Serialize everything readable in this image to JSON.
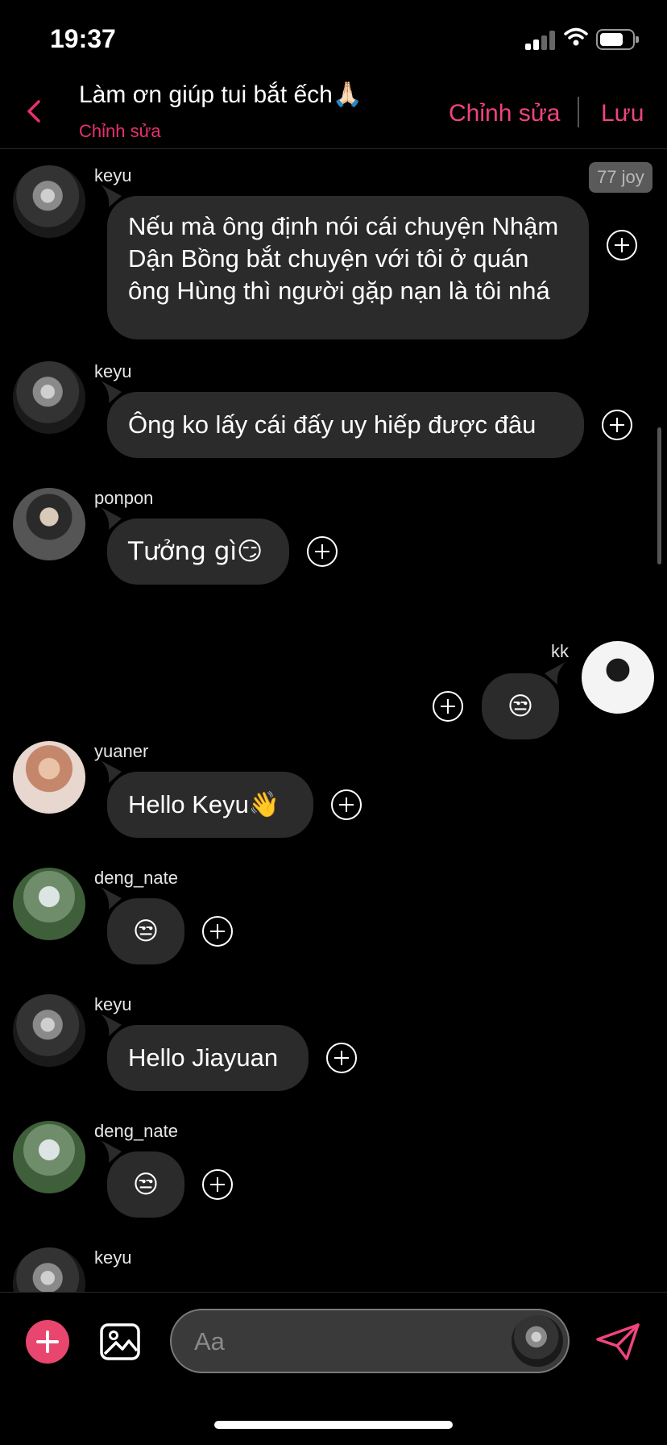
{
  "status": {
    "time": "19:37"
  },
  "header": {
    "title": "Làm ơn giúp tui bắt ếch🙏🏻",
    "subtitle": "Chỉnh sửa",
    "edit_label": "Chỉnh sửa",
    "save_label": "Lưu"
  },
  "joy_badge": "77 joy",
  "messages": [
    {
      "sender": "keyu",
      "text": "Nếu mà ông định nói cái chuyện Nhậm Dận Bồng bắt chuyện với tôi ở quán ông Hùng thì người gặp nạn là tôi nhá",
      "avatar": "keyu-avatar"
    },
    {
      "sender": "keyu",
      "text": "Ông ko lấy cái đấy uy hiếp được đâu",
      "avatar": "keyu-avatar"
    },
    {
      "sender": "ponpon",
      "text": "Tưởng gì😏",
      "avatar": "ponpon-avatar"
    },
    {
      "sender": "kk",
      "text": "😒",
      "avatar": "kk-avatar"
    },
    {
      "sender": "yuaner",
      "text": "Hello Keyu👋",
      "avatar": "yuaner-avatar"
    },
    {
      "sender": "deng_nate",
      "text": "😒",
      "avatar": "deng-nate-avatar"
    },
    {
      "sender": "keyu",
      "text": "Hello Jiayuan",
      "avatar": "keyu-avatar"
    },
    {
      "sender": "deng_nate",
      "text": "😒",
      "avatar": "deng-nate-avatar"
    },
    {
      "sender": "keyu",
      "text": "",
      "avatar": "keyu-avatar"
    }
  ],
  "composer": {
    "placeholder": "Aa"
  },
  "colors": {
    "accent": "#f0447d",
    "bubble": "#2b2b2b",
    "background": "#000000"
  }
}
